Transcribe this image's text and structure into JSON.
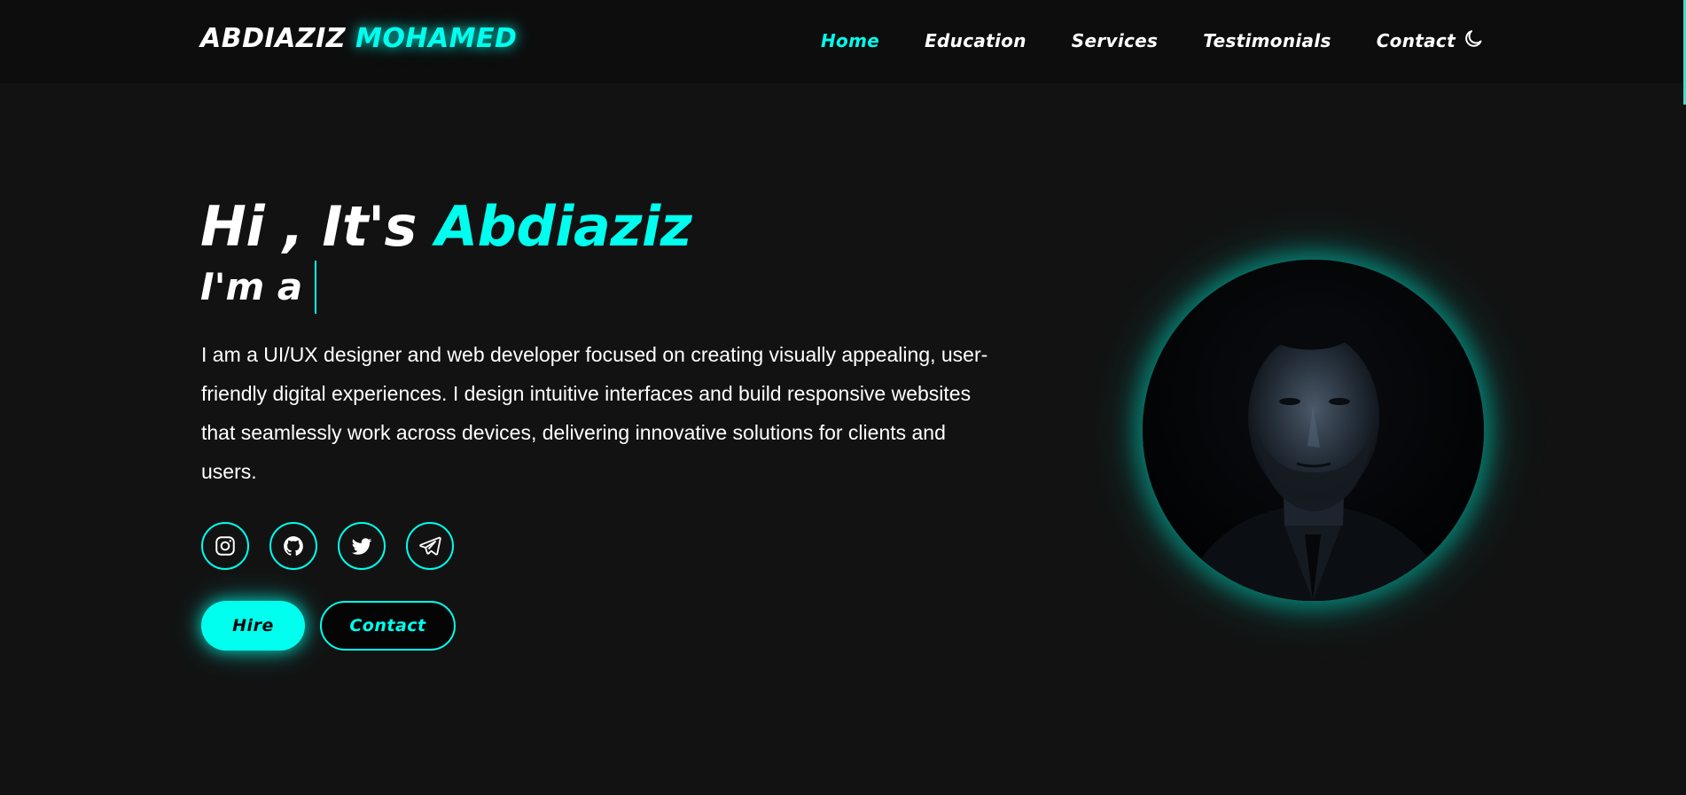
{
  "header": {
    "logo_first": "ABDIAZIZ",
    "logo_last": "MOHAMED",
    "nav": [
      {
        "label": "Home",
        "active": true
      },
      {
        "label": "Education",
        "active": false
      },
      {
        "label": "Services",
        "active": false
      },
      {
        "label": "Testimonials",
        "active": false
      },
      {
        "label": "Contact",
        "active": false
      }
    ],
    "theme_toggle_icon": "moon-icon"
  },
  "hero": {
    "greeting": "Hi , It's",
    "name": "Abdiaziz",
    "subtitle": "I'm a",
    "description": "I am a UI/UX designer and web developer focused on creating visually appealing, user-friendly digital experiences. I design intuitive interfaces and build responsive websites that seamlessly work across devices, delivering innovative solutions for clients and users.",
    "socials": [
      {
        "icon": "instagram-icon"
      },
      {
        "icon": "github-icon"
      },
      {
        "icon": "twitter-icon"
      },
      {
        "icon": "telegram-icon"
      }
    ],
    "hire_label": "Hire",
    "contact_label": "Contact"
  },
  "colors": {
    "accent": "#00ffee",
    "background": "#121212",
    "header_background": "#0d0d0d",
    "text": "#ffffff"
  }
}
